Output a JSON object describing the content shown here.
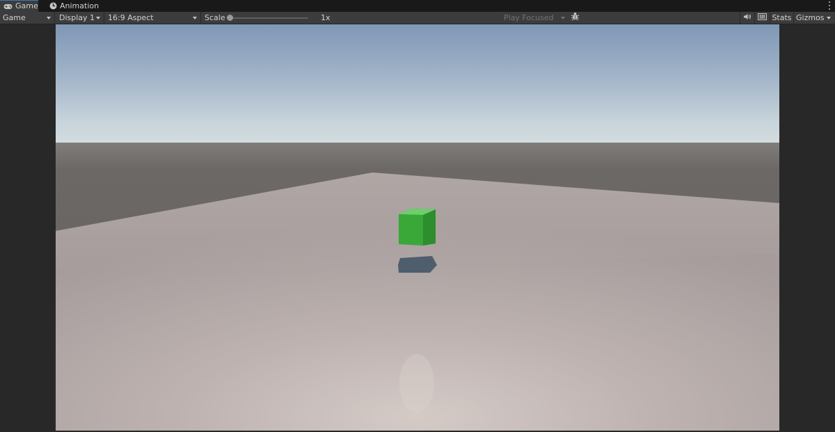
{
  "tabs": [
    {
      "label": "Game",
      "icon": "gamepad-icon",
      "active": true
    },
    {
      "label": "Animation",
      "icon": "animation-clock-icon",
      "active": false
    }
  ],
  "toolbar": {
    "view_mode": "Game",
    "display": "Display 1",
    "aspect": "16:9 Aspect",
    "scale_label": "Scale",
    "scale_value": "1x",
    "play_mode": "Play Focused",
    "stats_label": "Stats",
    "gizmos_label": "Gizmos"
  },
  "icons": {
    "menu": "kebab-menu-icon",
    "debug": "bug-icon",
    "audio": "speaker-icon",
    "stats_grid": "keyboard-grid-icon"
  },
  "scene": {
    "cube_color": "#3aa53a",
    "shadow_color": "#4a5a6a",
    "sky_color": "#8aa0bc",
    "ground_color": "#b8adaa"
  },
  "colors": {
    "accent": "#3a79bb",
    "panel": "#3c3c3c",
    "background": "#282828"
  }
}
